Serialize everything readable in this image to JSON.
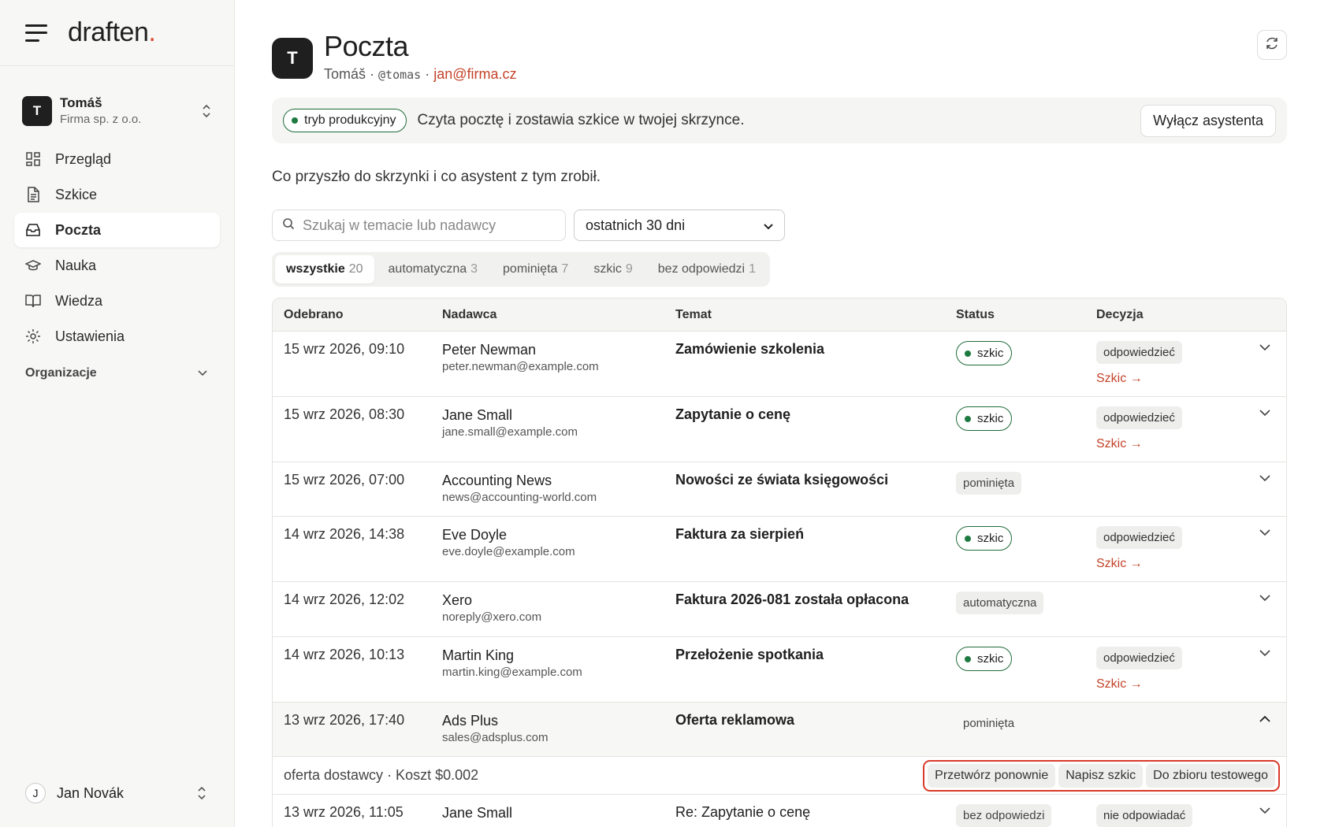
{
  "brand": {
    "name": "draften",
    "dot": "."
  },
  "org": {
    "initial": "T",
    "name": "Tomáš",
    "company": "Firma sp. z o.o."
  },
  "nav": [
    {
      "icon": "dashboard-icon",
      "label": "Przegląd"
    },
    {
      "icon": "document-icon",
      "label": "Szkice"
    },
    {
      "icon": "inbox-icon",
      "label": "Poczta",
      "active": true
    },
    {
      "icon": "graduation-cap-icon",
      "label": "Nauka"
    },
    {
      "icon": "book-icon",
      "label": "Wiedza"
    },
    {
      "icon": "gear-icon",
      "label": "Ustawienia"
    }
  ],
  "nav_section": "Organizacje",
  "user": {
    "initial": "J",
    "name": "Jan Novák"
  },
  "page": {
    "avatar": "T",
    "title": "Poczta",
    "owner": "Tomáš",
    "sep1": " · ",
    "handle": "@tomas",
    "sep2": " · ",
    "email": "jan@firma.cz"
  },
  "banner": {
    "mode": "tryb produkcyjny",
    "text": "Czyta pocztę i zostawia szkice w twojej skrzynce.",
    "button": "Wyłącz asystenta"
  },
  "lead": "Co przyszło do skrzynki i co asystent z tym zrobił.",
  "search": {
    "placeholder": "Szukaj w temacie lub nadawcy"
  },
  "range": {
    "value": "ostatnich 30 dni"
  },
  "tabs": [
    {
      "label": "wszystkie",
      "count": "20",
      "active": true
    },
    {
      "label": "automatyczna",
      "count": "3"
    },
    {
      "label": "pominięta",
      "count": "7"
    },
    {
      "label": "szkic",
      "count": "9"
    },
    {
      "label": "bez odpowiedzi",
      "count": "1"
    }
  ],
  "columns": {
    "received": "Odebrano",
    "sender": "Nadawca",
    "subject": "Temat",
    "status": "Status",
    "decision": "Decyzja"
  },
  "rows": [
    {
      "date": "15 wrz 2026, 09:10",
      "sender": "Peter Newman",
      "email": "peter.newman@example.com",
      "subject": "Zamówienie szkolenia",
      "status": "szkic",
      "decision": "odpowiedzieć",
      "link": "Szkic →"
    },
    {
      "date": "15 wrz 2026, 08:30",
      "sender": "Jane Small",
      "email": "jane.small@example.com",
      "subject": "Zapytanie o cenę",
      "status": "szkic",
      "decision": "odpowiedzieć",
      "link": "Szkic →"
    },
    {
      "date": "15 wrz 2026, 07:00",
      "sender": "Accounting News",
      "email": "news@accounting-world.com",
      "subject": "Nowości ze świata księgowości",
      "status": "pominięta"
    },
    {
      "date": "14 wrz 2026, 14:38",
      "sender": "Eve Doyle",
      "email": "eve.doyle@example.com",
      "subject": "Faktura za sierpień",
      "status": "szkic",
      "decision": "odpowiedzieć",
      "link": "Szkic →"
    },
    {
      "date": "14 wrz 2026, 12:02",
      "sender": "Xero",
      "email": "noreply@xero.com",
      "subject": "Faktura 2026-081 została opłacona",
      "status": "automatyczna"
    },
    {
      "date": "14 wrz 2026, 10:13",
      "sender": "Martin King",
      "email": "martin.king@example.com",
      "subject": "Przełożenie spotkania",
      "status": "szkic",
      "decision": "odpowiedzieć",
      "link": "Szkic →"
    },
    {
      "date": "13 wrz 2026, 17:40",
      "sender": "Ads Plus",
      "email": "sales@adsplus.com",
      "subject": "Oferta reklamowa",
      "status": "pominięta",
      "expanded": true
    },
    {
      "date": "13 wrz 2026, 11:05",
      "sender": "Jane Small",
      "email": "",
      "subject": "Re: Zapytanie o cenę",
      "status": "bez odpowiedzi",
      "decision": "nie odpowiadać"
    }
  ],
  "expanded_detail": {
    "text": "oferta dostawcy · Koszt $0.002",
    "actions": [
      "Przetwórz ponownie",
      "Napisz szkic",
      "Do zbioru testowego"
    ]
  },
  "colors": {
    "accent": "#c4442a",
    "status_green": "#1f7a42",
    "highlight": "#d93a2a"
  }
}
